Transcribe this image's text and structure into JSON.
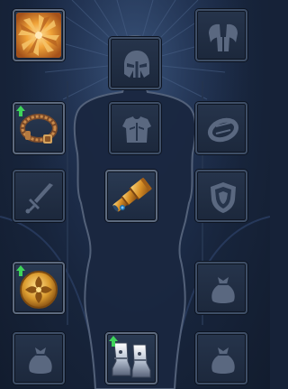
{
  "screen": {
    "name": "character-equipment-panel"
  },
  "slots": [
    {
      "id": "avatar",
      "icon": "sunburst-emblem-icon",
      "state": "equipped"
    },
    {
      "id": "head",
      "icon": "helmet-icon",
      "state": "empty"
    },
    {
      "id": "shoulders",
      "icon": "pauldrons-icon",
      "state": "empty"
    },
    {
      "id": "neck",
      "icon": "amulet-icon",
      "state": "equipped",
      "upgrade": true
    },
    {
      "id": "chest",
      "icon": "chest-armor-icon",
      "state": "empty"
    },
    {
      "id": "bracers",
      "icon": "bracer-icon",
      "state": "empty"
    },
    {
      "id": "main-hand",
      "icon": "sword-icon",
      "state": "empty"
    },
    {
      "id": "ranged",
      "icon": "spyglass-icon",
      "state": "equipped"
    },
    {
      "id": "off-hand",
      "icon": "shield-icon",
      "state": "empty"
    },
    {
      "id": "trinket",
      "icon": "golden-medallion-icon",
      "state": "equipped",
      "upgrade": true
    },
    {
      "id": "bag-right",
      "icon": "pouch-icon",
      "state": "empty"
    },
    {
      "id": "bag-left",
      "icon": "pouch-icon",
      "state": "empty"
    },
    {
      "id": "feet",
      "icon": "steel-boots-icon",
      "state": "equipped",
      "upgrade": true
    },
    {
      "id": "bag-bottom-right",
      "icon": "pouch-icon",
      "state": "empty"
    }
  ],
  "colors": {
    "background": "#1b2a44",
    "slot_border": "#3e4e66",
    "placeholder_icon": "#5a6880",
    "silhouette_outline": "#56647c",
    "upgrade_arrow": "#3fd35a",
    "gold": "#d9a23a"
  }
}
